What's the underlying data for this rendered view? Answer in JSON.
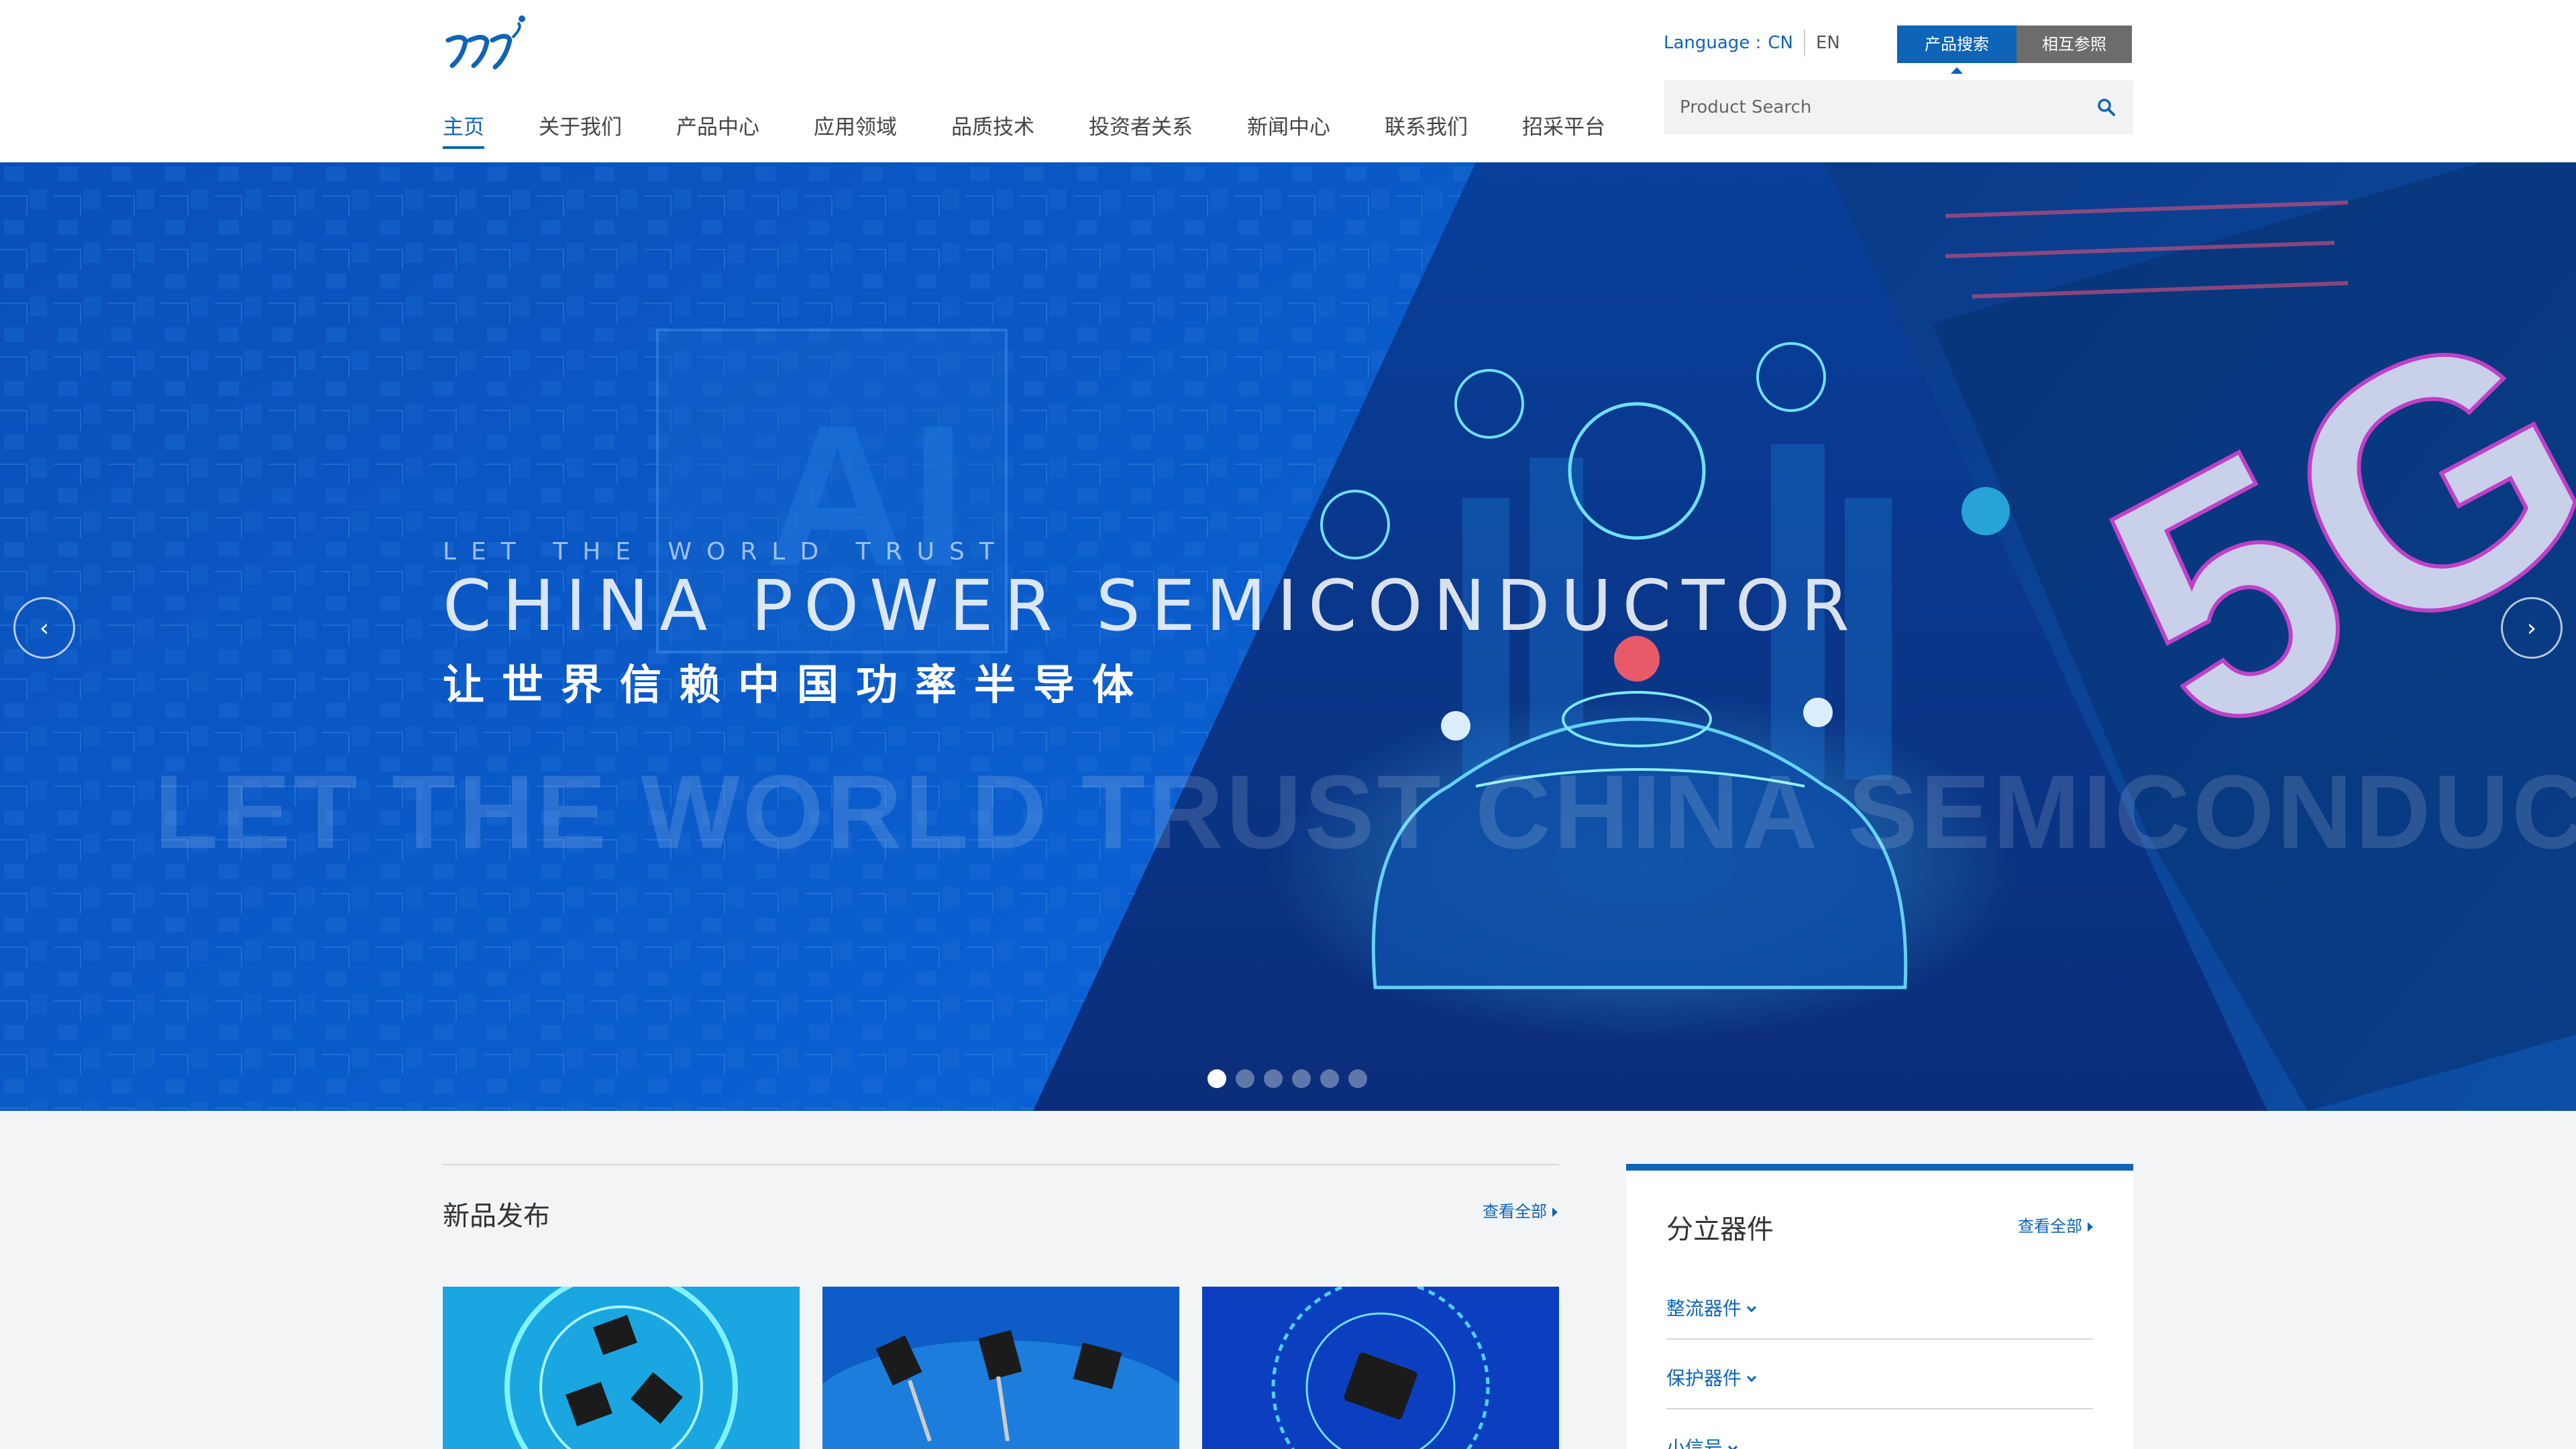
{
  "header": {
    "nav": [
      "主页",
      "关于我们",
      "产品中心",
      "应用领域",
      "品质技术",
      "投资者关系",
      "新闻中心",
      "联系我们",
      "招采平台"
    ],
    "language_label": "Language :",
    "lang_cn": "CN",
    "lang_en": "EN",
    "search_tabs": [
      "产品搜索",
      "相互参照"
    ],
    "search_placeholder": "Product Search"
  },
  "banner": {
    "subtitle": "LET THE WORLD TRUST",
    "title": "CHINA POWER SEMICONDUCTOR",
    "title_cn": "让世界信赖中国功率半导体",
    "ghost": "LET THE WORLD TRUST CHINA SEMICONDUCTOR",
    "slides_total": 6,
    "active_slide": 1,
    "badge_5g": "5G"
  },
  "new_products": {
    "title": "新品发布",
    "view_all": "查看全部"
  },
  "discrete": {
    "title": "分立器件",
    "view_all": "查看全部",
    "categories": [
      "整流器件",
      "保护器件",
      "小信号"
    ]
  },
  "colors": {
    "brand_blue": "#0e64b6",
    "tab_gray": "#6c6c6c",
    "banner_blue": "#0a55c2"
  }
}
